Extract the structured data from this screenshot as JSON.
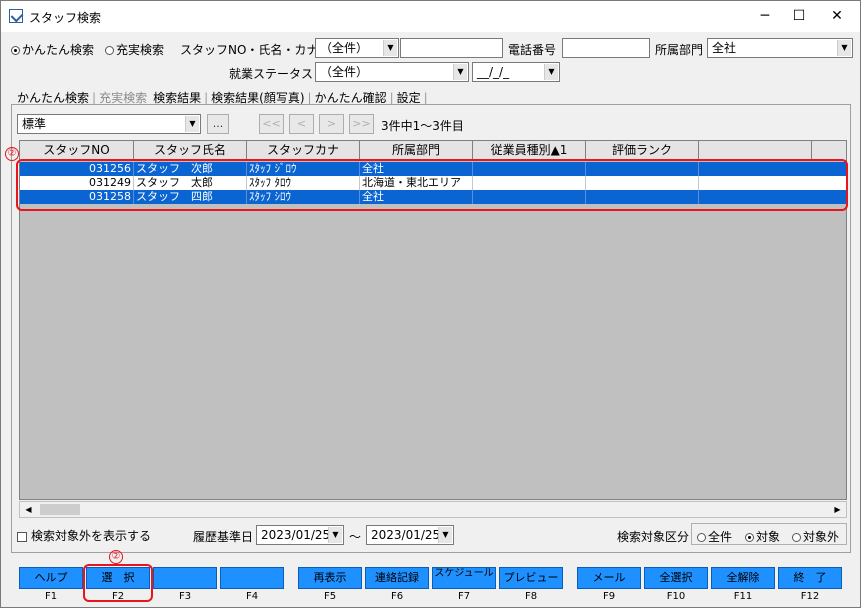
{
  "window": {
    "title": "スタッフ検索",
    "minimize": "─",
    "maximize": "☐",
    "close": "✕",
    "icon": "window-app-icon"
  },
  "search": {
    "mode_easy": "かんたん検索",
    "mode_full": "充実検索",
    "staff_label": "スタッフNO・氏名・カナ",
    "staff_filter_value": "（全件）",
    "staff_text_value": "",
    "phone_label": "電話番号",
    "phone_value": "",
    "dept_label": "所属部門",
    "dept_value": "全社",
    "employment_label": "就業ステータス",
    "employment_value": "（全件）",
    "employment_date": "__/_/_"
  },
  "tabs": [
    "かんたん検索",
    "充実検索",
    "検索結果",
    "検索結果(顔写真)",
    "かんたん確認",
    "設定"
  ],
  "results": {
    "view_value": "標準",
    "more_button": "...",
    "nav_first": "<<",
    "nav_prev": "<",
    "nav_next": ">",
    "nav_last": ">>",
    "count_text": "3件中1～3件目",
    "columns": [
      "スタッフNO",
      "スタッフ氏名",
      "スタッフカナ",
      "所属部門",
      "従業員種別▲1",
      "評価ランク",
      ""
    ],
    "rows": [
      {
        "no": "031256",
        "name": "スタッフ　次郎",
        "kana": "ｽﾀｯﾌ ｼﾞﾛｳ",
        "dept": "全社",
        "type": "",
        "rank": "",
        "selected": true
      },
      {
        "no": "031249",
        "name": "スタッフ　太郎",
        "kana": "ｽﾀｯﾌ ﾀﾛｳ",
        "dept": "北海道・東北エリア",
        "type": "",
        "rank": "",
        "selected": false
      },
      {
        "no": "031258",
        "name": "スタッフ　四郎",
        "kana": "ｽﾀｯﾌ ｼﾛｳ",
        "dept": "全社",
        "type": "",
        "rank": "",
        "selected": true
      }
    ]
  },
  "bottom": {
    "show_excluded_label": "検索対象外を表示する",
    "history_label": "履歴基準日",
    "date_from": "2023/01/25",
    "tilde": "～",
    "date_to": "2023/01/25",
    "scope_label": "検索対象区分",
    "scope_all": "全件",
    "scope_target": "対象",
    "scope_excluded": "対象外"
  },
  "markers": {
    "grid": "②",
    "select": "②"
  },
  "fkeys": [
    {
      "label": "ヘルプ",
      "key": "F1"
    },
    {
      "label": "選　択",
      "key": "F2"
    },
    {
      "label": "",
      "key": "F3"
    },
    {
      "label": "",
      "key": "F4"
    },
    {
      "label": "再表示",
      "key": "F5"
    },
    {
      "label": "連絡記録",
      "key": "F6"
    },
    {
      "label": "スケジュール",
      "key": "F7"
    },
    {
      "label": "プレビュー",
      "key": "F8"
    },
    {
      "label": "メール",
      "key": "F9"
    },
    {
      "label": "全選択",
      "key": "F10"
    },
    {
      "label": "全解除",
      "key": "F11"
    },
    {
      "label": "終　了",
      "key": "F12"
    }
  ],
  "colors": {
    "fkey": "#1e90ff",
    "selection": "#0a64d2",
    "highlight": "#e8141e"
  }
}
